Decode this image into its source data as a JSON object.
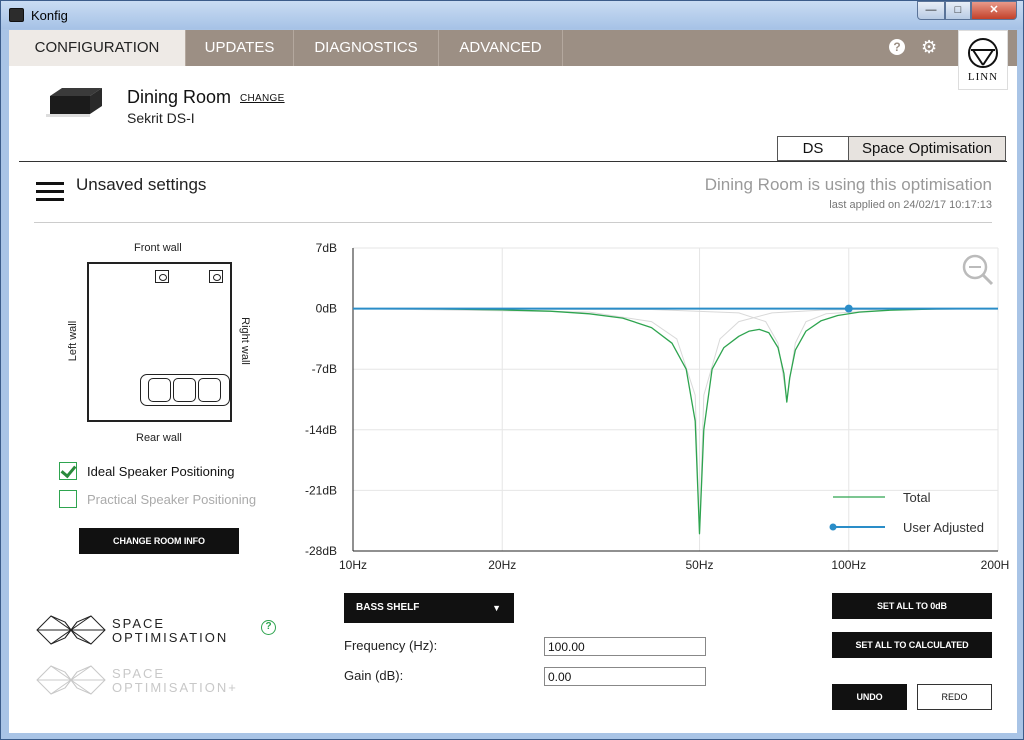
{
  "window": {
    "title": "Konfig"
  },
  "nav": {
    "tabs": [
      "CONFIGURATION",
      "UPDATES",
      "DIAGNOSTICS",
      "ADVANCED"
    ],
    "active_tab": "CONFIGURATION",
    "help_glyph": "?",
    "settings_glyph": "⚙",
    "brand": "LINN"
  },
  "device": {
    "room": "Dining Room",
    "change_label": "CHANGE",
    "model": "Sekrit DS-I"
  },
  "mode_tabs": {
    "ds": "DS",
    "space_optimisation": "Space Optimisation",
    "active": "Space Optimisation"
  },
  "status": {
    "unsaved": "Unsaved settings",
    "using": "Dining Room is using this optimisation",
    "last_applied": "last applied on 24/02/17 10:17:13"
  },
  "room": {
    "front_wall": "Front wall",
    "rear_wall": "Rear wall",
    "left_wall": "Left wall",
    "right_wall": "Right wall",
    "ideal_label": "Ideal Speaker Positioning",
    "ideal_checked": true,
    "practical_label": "Practical Speaker Positioning",
    "practical_checked": false,
    "change_room_info": "CHANGE ROOM INFO"
  },
  "logos": {
    "so_line1": "SPACE",
    "so_line2": "OPTIMISATION",
    "so_plus_line1": "SPACE",
    "so_plus_line2": "OPTIMISATION+",
    "help_glyph": "?"
  },
  "controls": {
    "filter_type": "BASS SHELF",
    "frequency_label": "Frequency (Hz):",
    "frequency_value": "100.00",
    "gain_label": "Gain (dB):",
    "gain_value": "0.00",
    "set_all_zero": "SET ALL TO 0dB",
    "set_all_calculated": "SET ALL TO CALCULATED",
    "undo": "UNDO",
    "redo": "REDO"
  },
  "colors": {
    "nav_bg": "#9c8f84",
    "total": "#2ea44f",
    "user_adjusted": "#2a8dc8",
    "accent_green": "#2ea44f"
  },
  "chart_data": {
    "type": "line",
    "x_scale": "log",
    "xlim": [
      10,
      200
    ],
    "ylim": [
      -28,
      7
    ],
    "x_ticks": [
      10,
      20,
      50,
      100,
      200
    ],
    "x_tick_labels": [
      "10Hz",
      "20Hz",
      "50Hz",
      "100Hz",
      "200Hz"
    ],
    "y_ticks": [
      7,
      0,
      -7,
      -14,
      -21,
      -28
    ],
    "y_tick_labels": [
      "7dB",
      "0dB",
      "-7dB",
      "-14dB",
      "-21dB",
      "-28dB"
    ],
    "grid": true,
    "legend": "bottom-right",
    "series": [
      {
        "name": "Total",
        "color": "#2ea44f",
        "x": [
          10,
          15,
          20,
          25,
          30,
          35,
          40,
          44,
          47,
          49,
          50,
          51,
          53,
          56,
          60,
          63,
          66,
          69,
          72,
          74,
          75,
          76,
          78,
          82,
          88,
          95,
          105,
          120,
          150,
          200
        ],
        "y": [
          0,
          -0.05,
          -0.15,
          -0.3,
          -0.6,
          -1.1,
          -2.2,
          -4.0,
          -7.0,
          -13.0,
          -26.0,
          -14.0,
          -7.0,
          -4.5,
          -3.2,
          -2.6,
          -2.4,
          -2.8,
          -4.5,
          -7.5,
          -10.8,
          -8.0,
          -4.8,
          -2.6,
          -1.4,
          -0.8,
          -0.4,
          -0.2,
          -0.05,
          0
        ]
      },
      {
        "name": "User Adjusted",
        "color": "#2a8dc8",
        "x": [
          10,
          200
        ],
        "y": [
          0,
          0
        ],
        "marker": {
          "x": 100,
          "y": 0
        }
      }
    ],
    "components": [
      {
        "x": [
          10,
          30,
          40,
          45,
          49,
          50,
          51,
          55,
          60,
          70,
          90,
          200
        ],
        "y": [
          0,
          -0.4,
          -1.5,
          -3.5,
          -10,
          -26,
          -10,
          -3.5,
          -1.5,
          -0.5,
          -0.15,
          0
        ]
      },
      {
        "x": [
          10,
          40,
          60,
          68,
          72,
          75,
          78,
          82,
          90,
          120,
          200
        ],
        "y": [
          0,
          -0.1,
          -0.5,
          -1.5,
          -4,
          -10.5,
          -4,
          -1.5,
          -0.6,
          -0.15,
          0
        ]
      }
    ]
  }
}
